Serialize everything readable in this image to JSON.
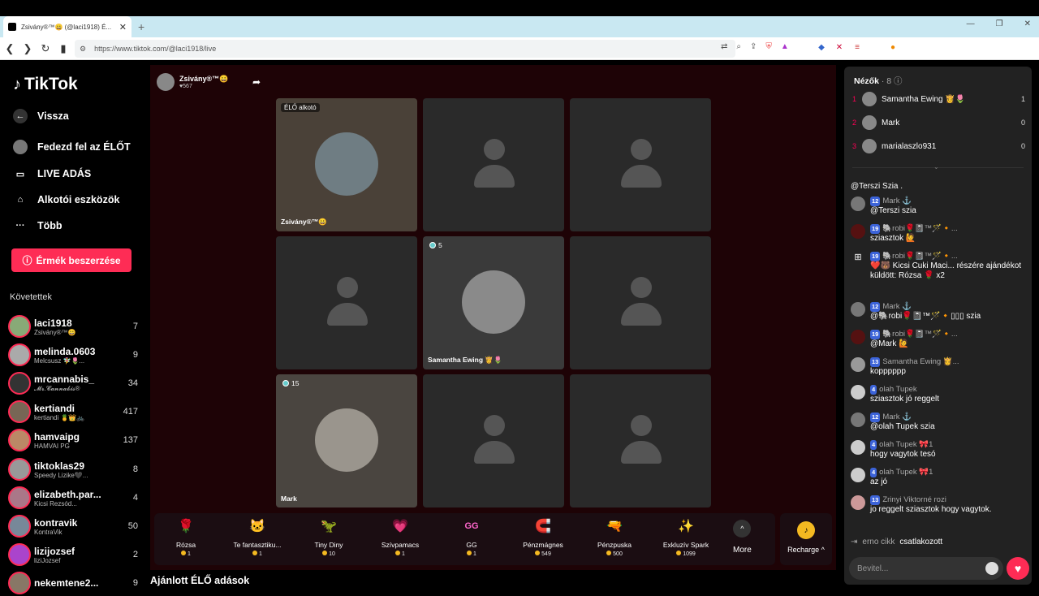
{
  "browser": {
    "tab_title": "Zsivány®™😀 (@laci1918) É...",
    "url": "https://www.tiktok.com/@laci1918/live",
    "window_controls": [
      "—",
      "❐",
      "✕"
    ]
  },
  "sidebar": {
    "logo": "TikTok",
    "nav": [
      {
        "label": "Vissza",
        "icon": "back-arrow-icon"
      },
      {
        "label": "Fedezd fel az ÉLŐT",
        "icon": "explore-icon"
      },
      {
        "label": "LIVE ADÁS",
        "icon": "camera-icon"
      },
      {
        "label": "Alkotói eszközök",
        "icon": "creator-tools-icon"
      },
      {
        "label": "Több",
        "icon": "more-dots-icon"
      }
    ],
    "coin_button": "Érmék beszerzése",
    "following_title": "Követettek",
    "following": [
      {
        "name": "laci1918",
        "sub": "Zsivány®™😀",
        "count": "7"
      },
      {
        "name": "melinda.0603",
        "sub": "Melcsusz 🧚‍♀️🌷...",
        "count": "9"
      },
      {
        "name": "mrcannabis_",
        "sub": "𝓜𝓻.𝓒𝓪𝓷𝓷𝓪𝓫𝓲𝓼®",
        "count": "34"
      },
      {
        "name": "kertiandi",
        "sub": "kertiandi 🍍👑🚲",
        "count": "417"
      },
      {
        "name": "hamvaipg",
        "sub": "HAMVAI PG",
        "count": "137"
      },
      {
        "name": "tiktoklas29",
        "sub": "Speedy Lizike🖤...",
        "count": "8"
      },
      {
        "name": "elizabeth.par...",
        "sub": "Kicsi Rezsód...",
        "count": "4"
      },
      {
        "name": "kontravik",
        "sub": "KontraVik",
        "count": "50"
      },
      {
        "name": "lizijozsef",
        "sub": "liziJozsef",
        "count": "2"
      },
      {
        "name": "nekemtene2...",
        "sub": "",
        "count": "9"
      }
    ]
  },
  "stream": {
    "host_name": "Zsivány®™😀",
    "host_likes": "♥567",
    "cells": [
      {
        "label": "Zsivány®™😀",
        "badge": "ÉLŐ alkotó",
        "viewers": ""
      },
      {
        "label": "Samantha Ewing 👸🌷",
        "badge": "",
        "viewers": "5"
      },
      {
        "label": "Mark",
        "badge": "",
        "viewers": "15"
      }
    ],
    "gifts": [
      {
        "name": "Rózsa",
        "price": "1",
        "emoji": "🌹"
      },
      {
        "name": "Te fantasztiku...",
        "price": "1",
        "emoji": "🐱"
      },
      {
        "name": "Tiny Diny",
        "price": "10",
        "emoji": "🦖"
      },
      {
        "name": "Szívpamacs",
        "price": "1",
        "emoji": "💗"
      },
      {
        "name": "GG",
        "price": "1",
        "emoji": "GG"
      },
      {
        "name": "Pénzmágnes",
        "price": "549",
        "emoji": "🧲"
      },
      {
        "name": "Pénzpuska",
        "price": "500",
        "emoji": "🔫"
      },
      {
        "name": "Exkluzív Spark",
        "price": "1099",
        "emoji": "✨"
      }
    ],
    "more_label": "More",
    "recharge_label": "Recharge ^"
  },
  "recommended": "Ajánlott ÉLŐ adások",
  "chat": {
    "viewers_title": "Nézők",
    "viewers_count": "· 8",
    "top_viewers": [
      {
        "rank": "1",
        "name": "Samantha Ewing 👸🌷",
        "score": "1"
      },
      {
        "rank": "2",
        "name": "Mark",
        "score": "0"
      },
      {
        "rank": "3",
        "name": "marialaszlo931",
        "score": "0"
      }
    ],
    "messages": [
      {
        "level": "",
        "name": "",
        "text": "@Terszi Szia ."
      },
      {
        "level": "12",
        "name": "Mark ⚓",
        "text": "@Terszi szia"
      },
      {
        "level": "19",
        "name": "🐘robi🌹📓™🪄🔸...",
        "text": "sziasztok 🙋"
      },
      {
        "level": "19",
        "name": "🐘robi🌹📓™🪄🔸...",
        "text": "❤️🐻 Kicsi Cuki Maci... részére ajándékot küldött: Rózsa 🌹 x2"
      },
      {
        "level": "12",
        "name": "Mark ⚓",
        "text": "@🐘robi🌹📓™🪄🔸▯▯▯ szia"
      },
      {
        "level": "19",
        "name": "🐘robi🌹📓™🪄🔸...",
        "text": "@Mark 🙋"
      },
      {
        "level": "13",
        "name": "Samantha Ewing 👸...",
        "text": "kopppppp"
      },
      {
        "level": "4",
        "name": "olah Tupek",
        "text": "sziasztok jó reggelt"
      },
      {
        "level": "12",
        "name": "Mark ⚓",
        "text": "@olah Tupek szia"
      },
      {
        "level": "4",
        "name": "olah Tupek 🎀1",
        "text": "hogy vagytok tesó"
      },
      {
        "level": "4",
        "name": "olah Tupek 🎀1",
        "text": "az jó"
      },
      {
        "level": "13",
        "name": "Zrinyi Viktorné rozi",
        "text": "jo reggelt sziasztok hogy vagytok."
      }
    ],
    "join_user": "erno cikk",
    "join_text": "csatlakozott",
    "input_placeholder": "Bevitel..."
  }
}
